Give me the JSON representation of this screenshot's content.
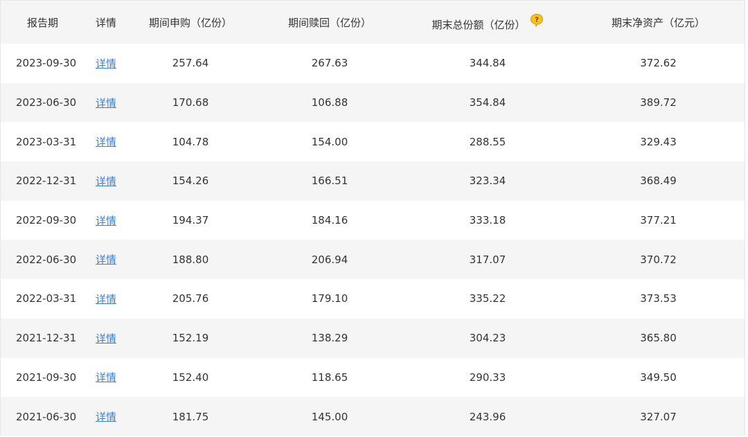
{
  "header": {
    "period": "报告期",
    "detail": "详情",
    "subscribe": "期间申购（亿份）",
    "redeem": "期间赎回（亿份）",
    "total_shares": "期末总份额（亿份）",
    "net_assets": "期末净资产（亿元）"
  },
  "help_icon": "question-bubble-icon",
  "colors": {
    "link": "#3a7fd5",
    "stripe": "#f5f5f5",
    "icon": "#f2b705"
  },
  "rows": [
    {
      "date": "2023-09-30",
      "detail": "详情",
      "subscribe": "257.64",
      "redeem": "267.63",
      "total_shares": "344.84",
      "net_assets": "372.62"
    },
    {
      "date": "2023-06-30",
      "detail": "详情",
      "subscribe": "170.68",
      "redeem": "106.88",
      "total_shares": "354.84",
      "net_assets": "389.72"
    },
    {
      "date": "2023-03-31",
      "detail": "详情",
      "subscribe": "104.78",
      "redeem": "154.00",
      "total_shares": "288.55",
      "net_assets": "329.43"
    },
    {
      "date": "2022-12-31",
      "detail": "详情",
      "subscribe": "154.26",
      "redeem": "166.51",
      "total_shares": "323.34",
      "net_assets": "368.49"
    },
    {
      "date": "2022-09-30",
      "detail": "详情",
      "subscribe": "194.37",
      "redeem": "184.16",
      "total_shares": "333.18",
      "net_assets": "377.21"
    },
    {
      "date": "2022-06-30",
      "detail": "详情",
      "subscribe": "188.80",
      "redeem": "206.94",
      "total_shares": "317.07",
      "net_assets": "370.72"
    },
    {
      "date": "2022-03-31",
      "detail": "详情",
      "subscribe": "205.76",
      "redeem": "179.10",
      "total_shares": "335.22",
      "net_assets": "373.53"
    },
    {
      "date": "2021-12-31",
      "detail": "详情",
      "subscribe": "152.19",
      "redeem": "138.29",
      "total_shares": "304.23",
      "net_assets": "365.80"
    },
    {
      "date": "2021-09-30",
      "detail": "详情",
      "subscribe": "152.40",
      "redeem": "118.65",
      "total_shares": "290.33",
      "net_assets": "349.50"
    },
    {
      "date": "2021-06-30",
      "detail": "详情",
      "subscribe": "181.75",
      "redeem": "145.00",
      "total_shares": "243.96",
      "net_assets": "327.07"
    }
  ]
}
